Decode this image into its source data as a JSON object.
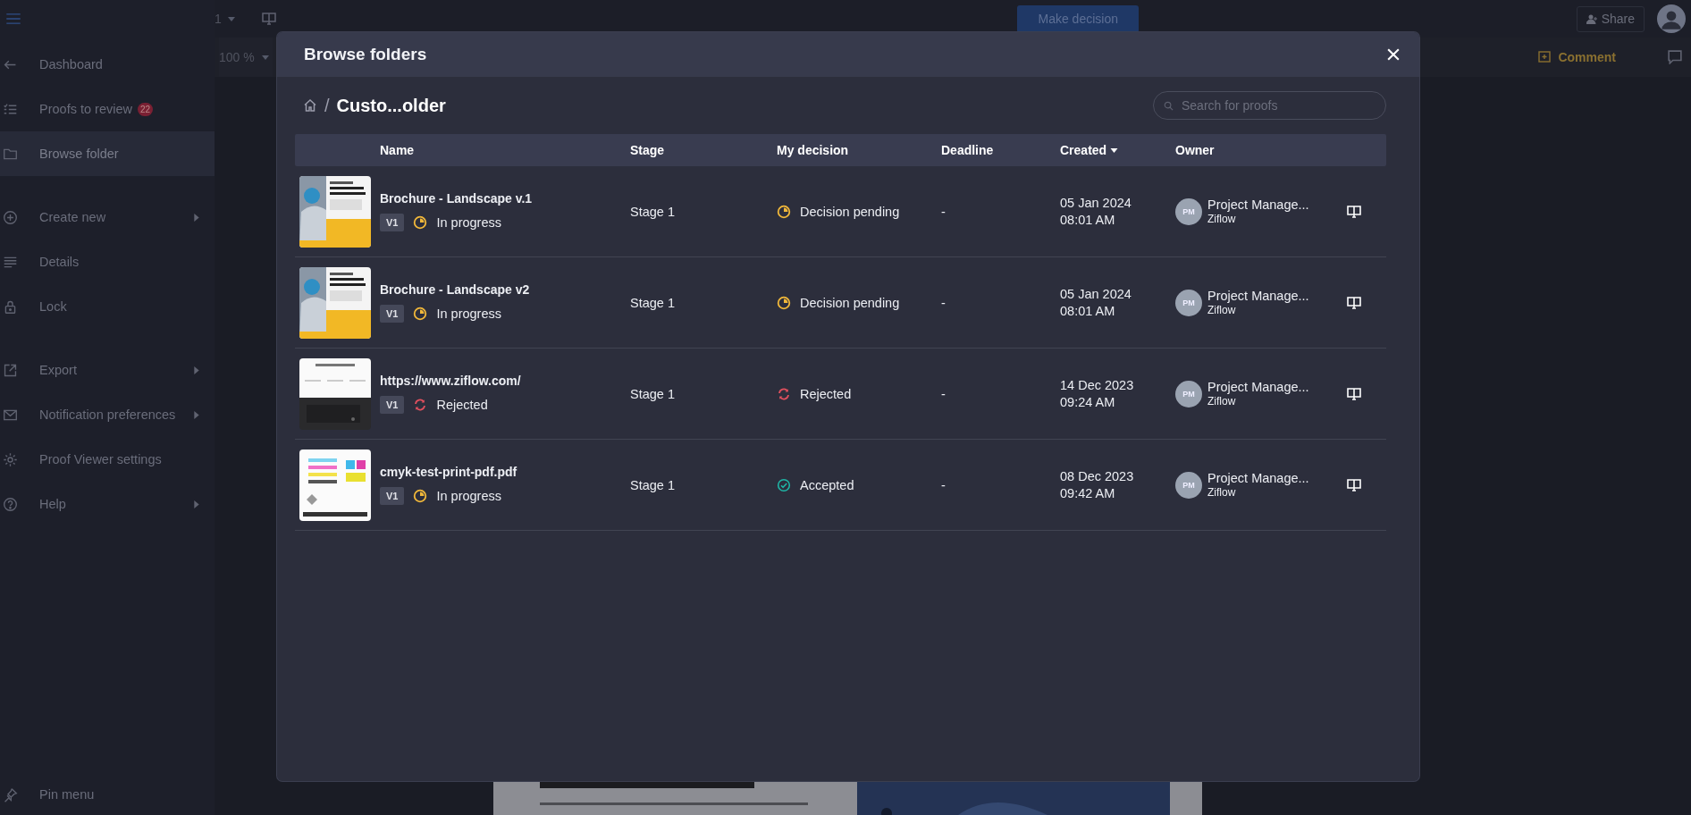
{
  "sidebar": {
    "items": [
      {
        "label": "Dashboard",
        "selected": false,
        "submenu": false
      },
      {
        "label": "Proofs to review",
        "selected": false,
        "submenu": false,
        "badge": "22"
      },
      {
        "label": "Browse folder",
        "selected": true,
        "submenu": false
      },
      {
        "label": "Create new",
        "selected": false,
        "submenu": true
      },
      {
        "label": "Details",
        "selected": false,
        "submenu": false
      },
      {
        "label": "Lock",
        "selected": false,
        "submenu": false
      },
      {
        "label": "Export",
        "selected": false,
        "submenu": true
      },
      {
        "label": "Notification preferences",
        "selected": false,
        "submenu": true
      },
      {
        "label": "Proof Viewer settings",
        "selected": false,
        "submenu": false
      },
      {
        "label": "Help",
        "selected": false,
        "submenu": true
      }
    ],
    "pin": "Pin menu"
  },
  "toolbar": {
    "page": "1",
    "zoom": "100 %",
    "decision_button": "Make decision",
    "share_button": "Share",
    "comment_button": "Comment"
  },
  "modal": {
    "title": "Browse folders",
    "breadcrumb_separator": "/",
    "breadcrumb": "Custo...older",
    "search": {
      "placeholder": "Search for proofs"
    },
    "columns": [
      {
        "label": "Name",
        "sorted": false
      },
      {
        "label": "Stage",
        "sorted": false
      },
      {
        "label": "My decision",
        "sorted": false
      },
      {
        "label": "Deadline",
        "sorted": false
      },
      {
        "label": "Created",
        "sorted": true
      },
      {
        "label": "Owner",
        "sorted": false
      }
    ],
    "rows": [
      {
        "name": "Brochure - Landscape v.1",
        "version": "V1",
        "status": {
          "kind": "pending",
          "label": "In progress"
        },
        "stage": "Stage 1",
        "decision": {
          "kind": "pending",
          "label": "Decision pending"
        },
        "deadline": "-",
        "created_date": "05 Jan 2024",
        "created_time": "08:01 AM",
        "owner": {
          "initials": "PM",
          "name": "Project Manage...",
          "company": "Ziflow"
        }
      },
      {
        "name": "Brochure - Landscape v2",
        "version": "V1",
        "status": {
          "kind": "pending",
          "label": "In progress"
        },
        "stage": "Stage 1",
        "decision": {
          "kind": "pending",
          "label": "Decision pending"
        },
        "deadline": "-",
        "created_date": "05 Jan 2024",
        "created_time": "08:01 AM",
        "owner": {
          "initials": "PM",
          "name": "Project Manage...",
          "company": "Ziflow"
        }
      },
      {
        "name": "https://www.ziflow.com/",
        "version": "V1",
        "status": {
          "kind": "rejected",
          "label": "Rejected"
        },
        "stage": "Stage 1",
        "decision": {
          "kind": "rejected",
          "label": "Rejected"
        },
        "deadline": "-",
        "created_date": "14 Dec 2023",
        "created_time": "09:24 AM",
        "owner": {
          "initials": "PM",
          "name": "Project Manage...",
          "company": "Ziflow"
        }
      },
      {
        "name": "cmyk-test-print-pdf.pdf",
        "version": "V1",
        "status": {
          "kind": "pending",
          "label": "In progress"
        },
        "stage": "Stage 1",
        "decision": {
          "kind": "accepted",
          "label": "Accepted"
        },
        "deadline": "-",
        "created_date": "08 Dec 2023",
        "created_time": "09:42 AM",
        "owner": {
          "initials": "PM",
          "name": "Project Manage...",
          "company": "Ziflow"
        }
      }
    ]
  }
}
